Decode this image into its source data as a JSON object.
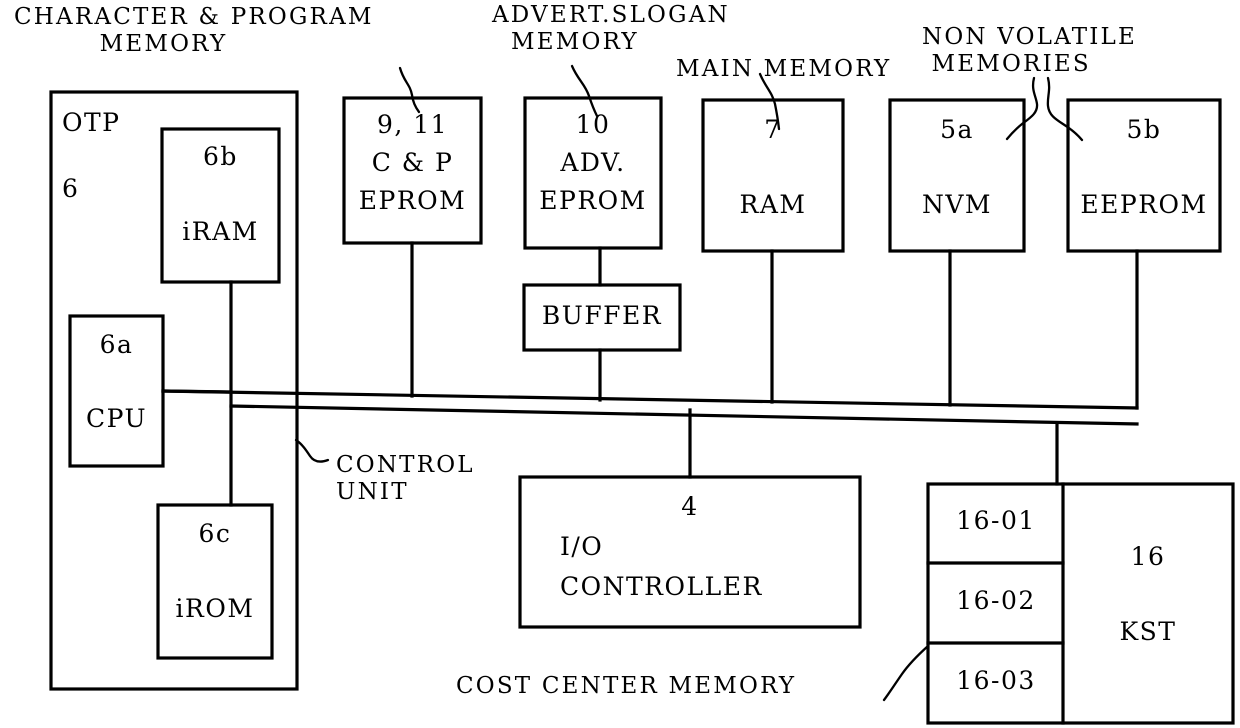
{
  "figure": {
    "kind": "patent-block-diagram",
    "ink_color": "#000000",
    "paper_color": "#ffffff"
  },
  "annotations": {
    "char_prog_memory": "CHARACTER & PROGRAM\n         MEMORY",
    "advert_slogan_memory": "ADVERT.SLOGAN\n  MEMORY",
    "main_memory": "MAIN MEMORY",
    "non_volatile_memories": "NON VOLATILE\n MEMORIES",
    "control_unit": "CONTROL\nUNIT",
    "cost_center_memory": "COST CENTER MEMORY"
  },
  "blocks": {
    "otp": {
      "ref": "OTP",
      "num": "6"
    },
    "iram": {
      "ref": "6b",
      "name": "iRAM"
    },
    "cpu": {
      "ref": "6a",
      "name": "CPU"
    },
    "irom": {
      "ref": "6c",
      "name": "iROM"
    },
    "cp_eprom": {
      "ref": "9, 11",
      "line2": "C & P",
      "name": "EPROM"
    },
    "adv_eprom": {
      "ref": "10",
      "line2": "ADV.",
      "name": "EPROM"
    },
    "buffer": {
      "name": "BUFFER"
    },
    "ram": {
      "ref": "7",
      "name": "RAM"
    },
    "nvm": {
      "ref": "5a",
      "name": "NVM"
    },
    "eeprom": {
      "ref": "5b",
      "name": "EEPROM"
    },
    "io_controller": {
      "ref": "4",
      "line2": "I/O",
      "name": "CONTROLLER"
    },
    "kst": {
      "ref": "16",
      "name": "KST"
    },
    "kst_cell_1": "16-01",
    "kst_cell_2": "16-02",
    "kst_cell_3": "16-03"
  }
}
